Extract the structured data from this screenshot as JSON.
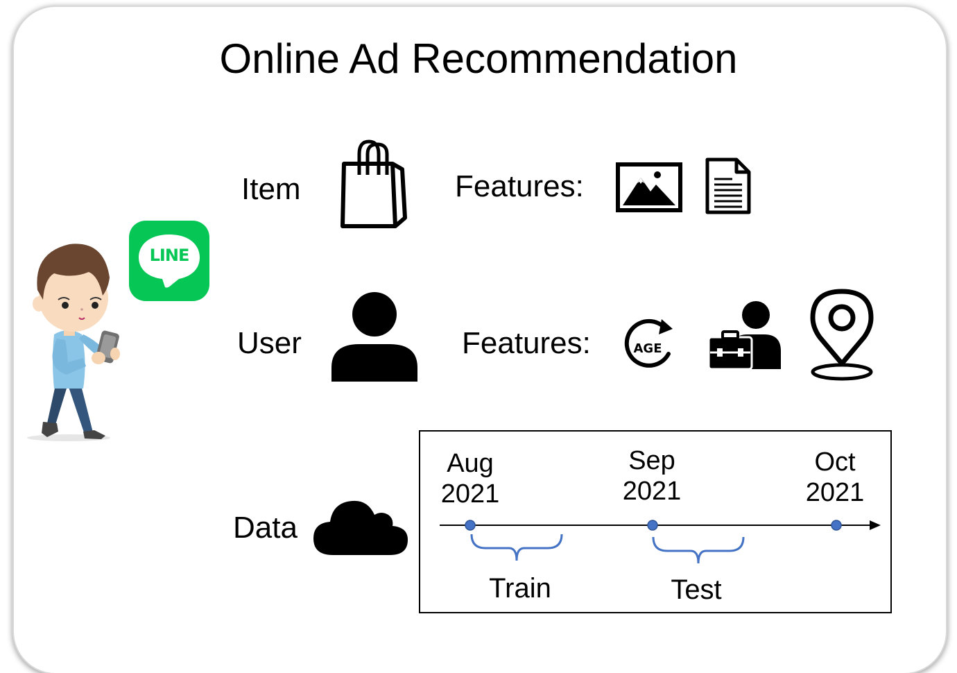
{
  "title": "Online Ad Recommendation",
  "line_logo": {
    "text": "LINE",
    "color": "#06C755"
  },
  "rows": {
    "item": {
      "label": "Item",
      "features_label": "Features:",
      "icon": "shopping-bag-icon",
      "feature_icons": [
        "image-icon",
        "document-icon"
      ]
    },
    "user": {
      "label": "User",
      "features_label": "Features:",
      "icon": "user-icon",
      "feature_icons": [
        "age-icon",
        "occupation-icon",
        "location-pin-icon"
      ]
    },
    "data": {
      "label": "Data",
      "icon": "cloud-icon"
    }
  },
  "age_icon_text": "AGE",
  "timeline": {
    "points": [
      {
        "month": "Aug",
        "year": "2021"
      },
      {
        "month": "Sep",
        "year": "2021"
      },
      {
        "month": "Oct",
        "year": "2021"
      }
    ],
    "splits": [
      {
        "label": "Train"
      },
      {
        "label": "Test"
      }
    ],
    "accent_color": "#4472C4"
  }
}
